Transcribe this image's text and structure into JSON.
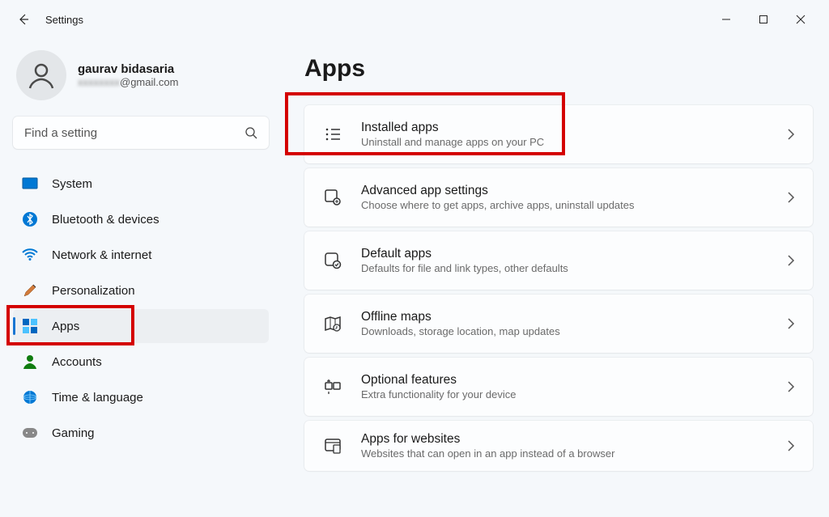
{
  "window": {
    "title": "Settings"
  },
  "profile": {
    "name": "gaurav bidasaria",
    "email_suffix": "@gmail.com"
  },
  "search": {
    "placeholder": "Find a setting"
  },
  "sidebar": {
    "items": [
      {
        "label": "System",
        "icon": "system"
      },
      {
        "label": "Bluetooth & devices",
        "icon": "bluetooth"
      },
      {
        "label": "Network & internet",
        "icon": "wifi"
      },
      {
        "label": "Personalization",
        "icon": "brush"
      },
      {
        "label": "Apps",
        "icon": "apps",
        "selected": true
      },
      {
        "label": "Accounts",
        "icon": "account"
      },
      {
        "label": "Time & language",
        "icon": "globe"
      },
      {
        "label": "Gaming",
        "icon": "gaming"
      }
    ]
  },
  "page": {
    "title": "Apps",
    "cards": [
      {
        "title": "Installed apps",
        "sub": "Uninstall and manage apps on your PC",
        "icon": "installed"
      },
      {
        "title": "Advanced app settings",
        "sub": "Choose where to get apps, archive apps, uninstall updates",
        "icon": "advanced"
      },
      {
        "title": "Default apps",
        "sub": "Defaults for file and link types, other defaults",
        "icon": "default"
      },
      {
        "title": "Offline maps",
        "sub": "Downloads, storage location, map updates",
        "icon": "maps"
      },
      {
        "title": "Optional features",
        "sub": "Extra functionality for your device",
        "icon": "optional"
      },
      {
        "title": "Apps for websites",
        "sub": "Websites that can open in an app instead of a browser",
        "icon": "websites"
      }
    ]
  }
}
